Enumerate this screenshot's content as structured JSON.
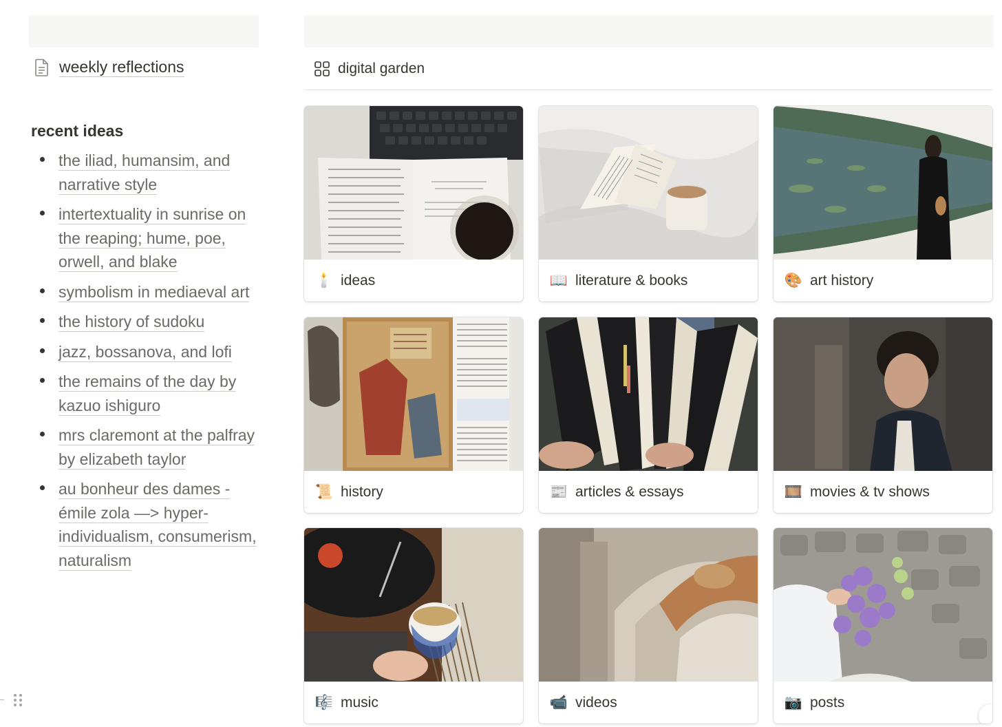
{
  "left": {
    "page_link": {
      "label": "weekly reflections",
      "icon": "document-icon"
    },
    "recent_heading": "recent ideas",
    "ideas": [
      "the iliad, humansim, and narrative style",
      "intertextuality in sunrise on the reaping; hume, poe, orwell, and blake",
      "symbolism in mediaeval art",
      "the history of sudoku",
      "jazz, bossanova, and lofi",
      "the remains of the day by kazuo ishiguro",
      "mrs claremont at the palfray by elizabeth taylor",
      "au bonheur des dames - émile zola —> hyper-individualism, consumerism, naturalism"
    ]
  },
  "database": {
    "title": "digital garden",
    "icon": "gallery-grid-icon",
    "cards": [
      {
        "title": "ideas",
        "emoji": "🕯️"
      },
      {
        "title": "literature & books",
        "emoji": "📖"
      },
      {
        "title": "art history",
        "emoji": "🎨"
      },
      {
        "title": "history",
        "emoji": "📜"
      },
      {
        "title": "articles & essays",
        "emoji": "📰"
      },
      {
        "title": "movies & tv shows",
        "emoji": "🎞️"
      },
      {
        "title": "music",
        "emoji": "🎼"
      },
      {
        "title": "videos",
        "emoji": "📹"
      },
      {
        "title": "posts",
        "emoji": "📷"
      }
    ]
  },
  "colors": {
    "text": "#37352f",
    "link_muted": "#6b6a66",
    "cover_bg": "#f7f7f5",
    "divider": "#e3e2de"
  }
}
